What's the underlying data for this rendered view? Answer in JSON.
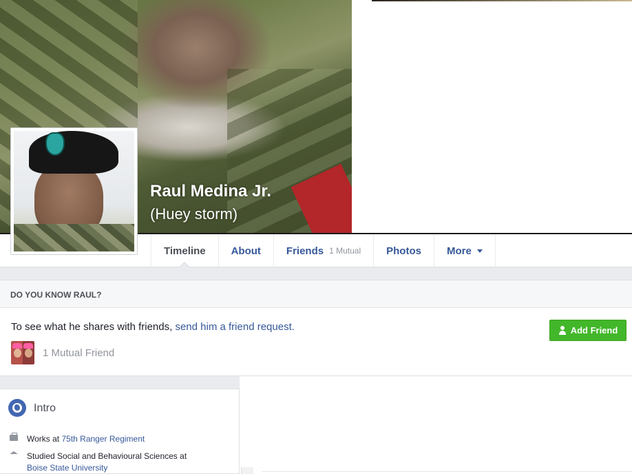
{
  "profile": {
    "name": "Raul Medina Jr.",
    "alt_name": "(Huey storm)"
  },
  "nav": {
    "tabs": [
      {
        "label": "Timeline",
        "active": true
      },
      {
        "label": "About"
      },
      {
        "label": "Friends",
        "sub": "1 Mutual"
      },
      {
        "label": "Photos"
      },
      {
        "label": "More"
      }
    ]
  },
  "know_card": {
    "header": "DO YOU KNOW RAUL?",
    "text": "To see what he shares with friends, ",
    "link": "send him a friend request.",
    "add_friend_label": "Add Friend",
    "mutual_friends": "1 Mutual Friend"
  },
  "intro": {
    "title": "Intro",
    "works_prefix": "Works at ",
    "works_place": "75th Ranger Regiment",
    "studied_prefix": "Studied Social and Behavioural Sciences at",
    "studied_place": "Boise State University"
  },
  "colors": {
    "link": "#365899",
    "add_friend_button": "#42b72a",
    "background": "#e9ebee"
  },
  "icons": [
    "globe-icon",
    "briefcase-icon",
    "school-icon",
    "add-person-icon",
    "caret-down-icon"
  ]
}
